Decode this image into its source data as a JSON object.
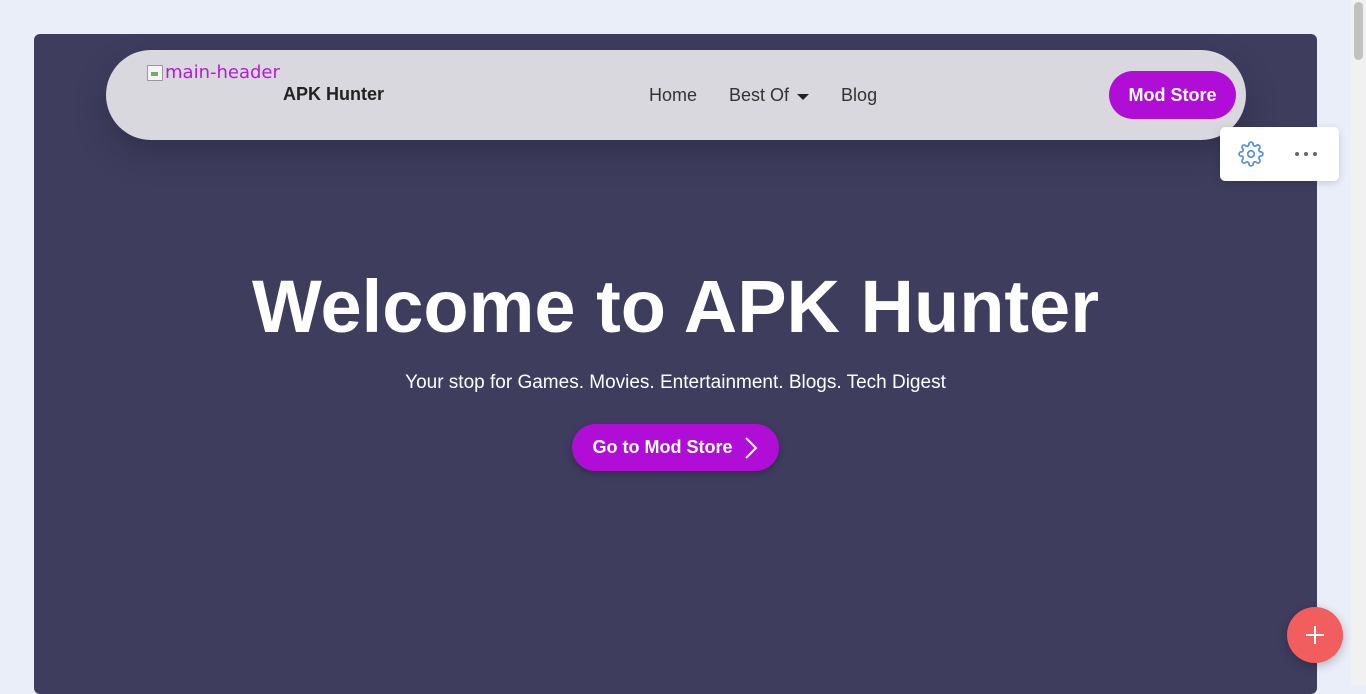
{
  "header": {
    "logo_alt": "main-header",
    "brand": "APK Hunter",
    "nav": {
      "home": "Home",
      "best_of": "Best Of",
      "blog": "Blog"
    },
    "cta": "Mod Store"
  },
  "hero": {
    "title": "Welcome to APK Hunter",
    "subtitle": "Your stop for Games. Movies. Entertainment. Blogs. Tech Digest",
    "button": "Go to Mod Store"
  },
  "editor_toolbar": {
    "icons": [
      "gear-icon",
      "more-horizontal-icon"
    ]
  },
  "fab": {
    "icon": "plus-icon"
  },
  "colors": {
    "page_bg": "#eaeef8",
    "hero_bg": "#3e3d5e",
    "navbar_bg": "#d8d8de",
    "accent": "#b00ed6",
    "fab": "#f25d5d"
  }
}
